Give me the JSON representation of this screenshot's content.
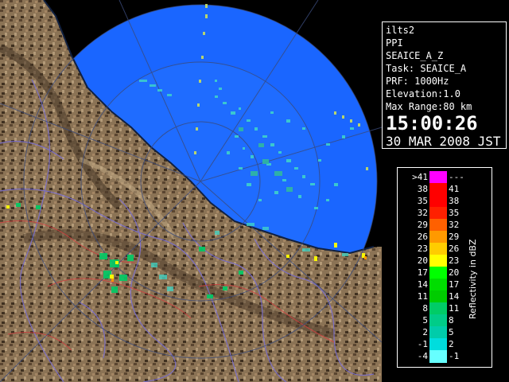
{
  "info": {
    "station": "ilts2",
    "scan_mode": "PPI",
    "product": "SEAICE_A_Z",
    "task": "Task: SEAICE_A",
    "prf": "PRF: 1000Hz",
    "elevation": "Elevation:1.0",
    "max_range": "Max Range:80 km",
    "time": "15:00:26",
    "date": "30 MAR 2008 JST"
  },
  "legend": {
    "unit_label": "Reflectivity in dBZ",
    "rows": [
      {
        "lower": ">41",
        "upper": "---",
        "color": "#ff00ff"
      },
      {
        "lower": "38",
        "upper": "41",
        "color": "#ff0000"
      },
      {
        "lower": "35",
        "upper": "38",
        "color": "#ff0000"
      },
      {
        "lower": "32",
        "upper": "35",
        "color": "#ff2000"
      },
      {
        "lower": "29",
        "upper": "32",
        "color": "#ff6000"
      },
      {
        "lower": "26",
        "upper": "29",
        "color": "#ff9900"
      },
      {
        "lower": "23",
        "upper": "26",
        "color": "#ffcc00"
      },
      {
        "lower": "20",
        "upper": "23",
        "color": "#ffff00"
      },
      {
        "lower": "17",
        "upper": "20",
        "color": "#00ff00"
      },
      {
        "lower": "14",
        "upper": "17",
        "color": "#00dd00"
      },
      {
        "lower": "11",
        "upper": "14",
        "color": "#00cc00"
      },
      {
        "lower": "8",
        "upper": "11",
        "color": "#00cc66"
      },
      {
        "lower": "5",
        "upper": "8",
        "color": "#00cc88"
      },
      {
        "lower": "2",
        "upper": "5",
        "color": "#00ccaa"
      },
      {
        "lower": "-1",
        "upper": "2",
        "color": "#00dddd"
      },
      {
        "lower": "-4",
        "upper": "-1",
        "color": "#66ffff"
      }
    ]
  },
  "colors": {
    "sea": "#1a66ff",
    "outside": "#000000",
    "land": "#8b7355",
    "echo": "#40e0d0"
  }
}
